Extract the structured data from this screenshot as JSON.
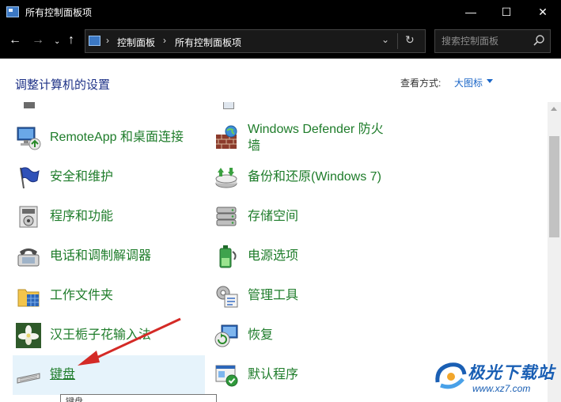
{
  "window": {
    "title": "所有控制面板项",
    "minimize_symbol": "—",
    "maximize_symbol": "☐",
    "close_symbol": "✕"
  },
  "navigation": {
    "back_symbol": "←",
    "forward_symbol": "→",
    "recent_symbol": "⌄",
    "up_symbol": "↑",
    "breadcrumb": [
      "控制面板",
      "所有控制面板项"
    ],
    "separator": "›",
    "dropdown_symbol": "⌄",
    "refresh_symbol": "↻",
    "search_placeholder": "搜索控制面板"
  },
  "header": {
    "heading": "调整计算机的设置",
    "view_label": "查看方式:",
    "view_value": "大图标"
  },
  "items": {
    "remoteapp": {
      "label": "RemoteApp 和桌面连接",
      "icon": "remote-desktop-icon"
    },
    "defender_line1": "Windows Defender 防火",
    "defender_line2": "墙",
    "defender_icon": "firewall-icon",
    "security": {
      "label": "安全和维护",
      "icon": "flag-icon"
    },
    "backup": {
      "label": "备份和还原(Windows 7)",
      "icon": "backup-icon"
    },
    "programs": {
      "label": "程序和功能",
      "icon": "programs-icon"
    },
    "storage": {
      "label": "存储空间",
      "icon": "storage-icon"
    },
    "phone": {
      "label": "电话和调制解调器",
      "icon": "phone-modem-icon"
    },
    "power": {
      "label": "电源选项",
      "icon": "power-icon"
    },
    "workfolders": {
      "label": "工作文件夹",
      "icon": "work-folders-icon"
    },
    "admin": {
      "label": "管理工具",
      "icon": "admin-tools-icon"
    },
    "ime": {
      "label": "汉王栀子花输入法",
      "icon": "flower-icon"
    },
    "recovery": {
      "label": "恢复",
      "icon": "recovery-icon"
    },
    "keyboard": {
      "label": "键盘",
      "icon": "keyboard-icon"
    },
    "defaults": {
      "label": "默认程序",
      "icon": "default-programs-icon"
    }
  },
  "tooltip": "键盘",
  "watermark": {
    "title": "极光下载站",
    "url": "www.xz7.com"
  },
  "colors": {
    "link_green": "#1e7c2a",
    "heading_blue": "#1e3287",
    "annotation_red": "#d42a26",
    "hover_bg": "#e6f3fb"
  }
}
